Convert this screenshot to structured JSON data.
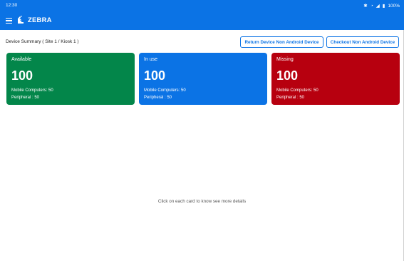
{
  "status_bar": {
    "time": "12:30",
    "battery": "100%"
  },
  "app": {
    "brand": "ZEBRA"
  },
  "summary": {
    "title": "Device Summary ( Site 1 / Kiosk 1 )"
  },
  "actions": {
    "return_label": "Return Device Non Android Device",
    "checkout_label": "Checkout Non Android Device"
  },
  "cards": [
    {
      "title": "Available",
      "count": "100",
      "mobile": "Mobile Computers: 50",
      "peripheral": "Peripheral : 50",
      "color": "#03864a"
    },
    {
      "title": "In use",
      "count": "100",
      "mobile": "Mobile Computers: 50",
      "peripheral": "Peripheral : 50",
      "color": "#0b73e5"
    },
    {
      "title": "Missing",
      "count": "100",
      "mobile": "Mobile Computers: 50",
      "peripheral": "Peripheral : 50",
      "color": "#b7000f"
    }
  ],
  "hint": "Click on each card to know see more details",
  "theme": {
    "primary": "#0b73e5"
  }
}
